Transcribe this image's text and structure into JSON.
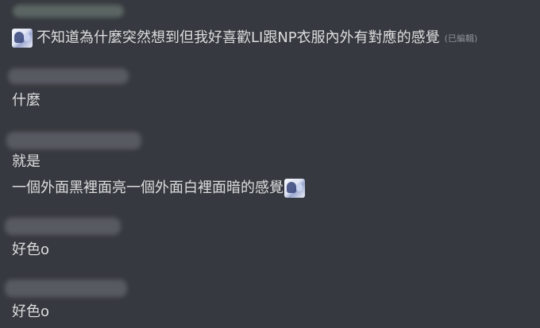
{
  "messages": [
    {
      "lines": [
        {
          "text": "不知道為什麼突然想到但我好喜歡LI跟NP衣服內外有對應的感覺",
          "edited": "(已編輯)"
        }
      ]
    },
    {
      "lines": [
        {
          "text": "什麼"
        }
      ]
    },
    {
      "lines": [
        {
          "text": "就是"
        },
        {
          "text": "一個外面黑裡面亮一個外面白裡面暗的感覺"
        }
      ]
    },
    {
      "lines": [
        {
          "text": "好色o"
        }
      ]
    },
    {
      "lines": [
        {
          "text": "好色o"
        }
      ]
    }
  ],
  "icons": {
    "custom_emoji": "anime-character-emoji-icon"
  }
}
